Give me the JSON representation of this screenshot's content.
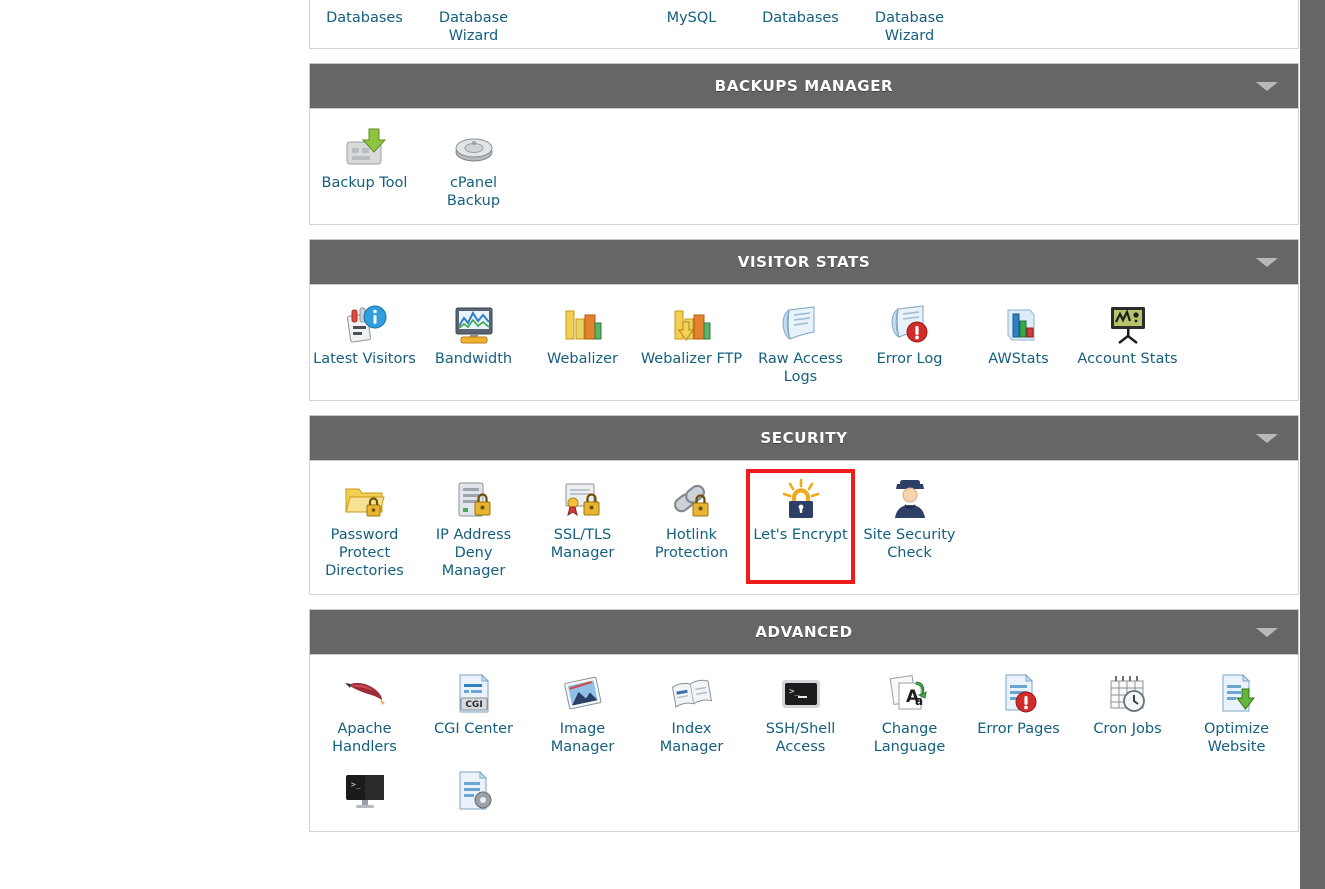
{
  "page": {
    "accent_link_color": "#15607f",
    "header_bg_color": "#666666",
    "highlight_color": "#ee1c1c",
    "gutter_color": "#666666"
  },
  "partial_top_group": {
    "visible_labels": [
      "Databases",
      "Database Wizard",
      "MySQL",
      "Databases",
      "Database Wizard"
    ],
    "items": [
      {
        "label": "Databases",
        "icon": "database-icon"
      },
      {
        "label": "Database Wizard",
        "icon": "database-wizard-icon"
      },
      {
        "label": "",
        "icon": ""
      },
      {
        "label": "MySQL",
        "icon": "mysql-icon"
      },
      {
        "label": "Databases",
        "icon": "database-icon"
      },
      {
        "label": "Database Wizard",
        "icon": "database-wizard-icon"
      }
    ]
  },
  "groups": [
    {
      "title": "Backups Manager",
      "collapse_icon": "chevron-down-icon",
      "items": [
        {
          "label": "Backup Tool",
          "icon": "backup-tool-icon",
          "highlighted": false
        },
        {
          "label": "cPanel Backup",
          "icon": "cpanel-backup-icon",
          "highlighted": false
        }
      ]
    },
    {
      "title": "Visitor Stats",
      "collapse_icon": "chevron-down-icon",
      "items": [
        {
          "label": "Latest Visitors",
          "icon": "latest-visitors-icon",
          "highlighted": false
        },
        {
          "label": "Bandwidth",
          "icon": "bandwidth-icon",
          "highlighted": false
        },
        {
          "label": "Webalizer",
          "icon": "webalizer-icon",
          "highlighted": false
        },
        {
          "label": "Webalizer FTP",
          "icon": "webalizer-ftp-icon",
          "highlighted": false
        },
        {
          "label": "Raw Access Logs",
          "icon": "raw-access-logs-icon",
          "highlighted": false
        },
        {
          "label": "Error Log",
          "icon": "error-log-icon",
          "highlighted": false
        },
        {
          "label": "AWStats",
          "icon": "awstats-icon",
          "highlighted": false
        },
        {
          "label": "Account Stats",
          "icon": "account-stats-icon",
          "highlighted": false
        }
      ]
    },
    {
      "title": "Security",
      "collapse_icon": "chevron-down-icon",
      "items": [
        {
          "label": "Password Protect Directories",
          "icon": "password-protect-directories-icon",
          "highlighted": false
        },
        {
          "label": "IP Address Deny Manager",
          "icon": "ip-address-deny-manager-icon",
          "highlighted": false
        },
        {
          "label": "SSL/TLS Manager",
          "icon": "ssl-tls-manager-icon",
          "highlighted": false
        },
        {
          "label": "Hotlink Protection",
          "icon": "hotlink-protection-icon",
          "highlighted": false
        },
        {
          "label": "Let's Encrypt",
          "icon": "lets-encrypt-icon",
          "highlighted": true
        },
        {
          "label": "Site Security Check",
          "icon": "site-security-check-icon",
          "highlighted": false
        }
      ]
    },
    {
      "title": "Advanced",
      "collapse_icon": "chevron-down-icon",
      "items": [
        {
          "label": "Apache Handlers",
          "icon": "apache-handlers-icon",
          "highlighted": false
        },
        {
          "label": "CGI Center",
          "icon": "cgi-center-icon",
          "highlighted": false
        },
        {
          "label": "Image Manager",
          "icon": "image-manager-icon",
          "highlighted": false
        },
        {
          "label": "Index Manager",
          "icon": "index-manager-icon",
          "highlighted": false
        },
        {
          "label": "SSH/Shell Access",
          "icon": "ssh-shell-access-icon",
          "highlighted": false
        },
        {
          "label": "Change Language",
          "icon": "change-language-icon",
          "highlighted": false
        },
        {
          "label": "Error Pages",
          "icon": "error-pages-icon",
          "highlighted": false
        },
        {
          "label": "Cron Jobs",
          "icon": "cron-jobs-icon",
          "highlighted": false
        },
        {
          "label": "Optimize Website",
          "icon": "optimize-website-icon",
          "highlighted": false
        },
        {
          "label": "",
          "icon": "terminal-icon",
          "highlighted": false
        },
        {
          "label": "",
          "icon": "mime-types-icon",
          "highlighted": false
        }
      ]
    }
  ]
}
